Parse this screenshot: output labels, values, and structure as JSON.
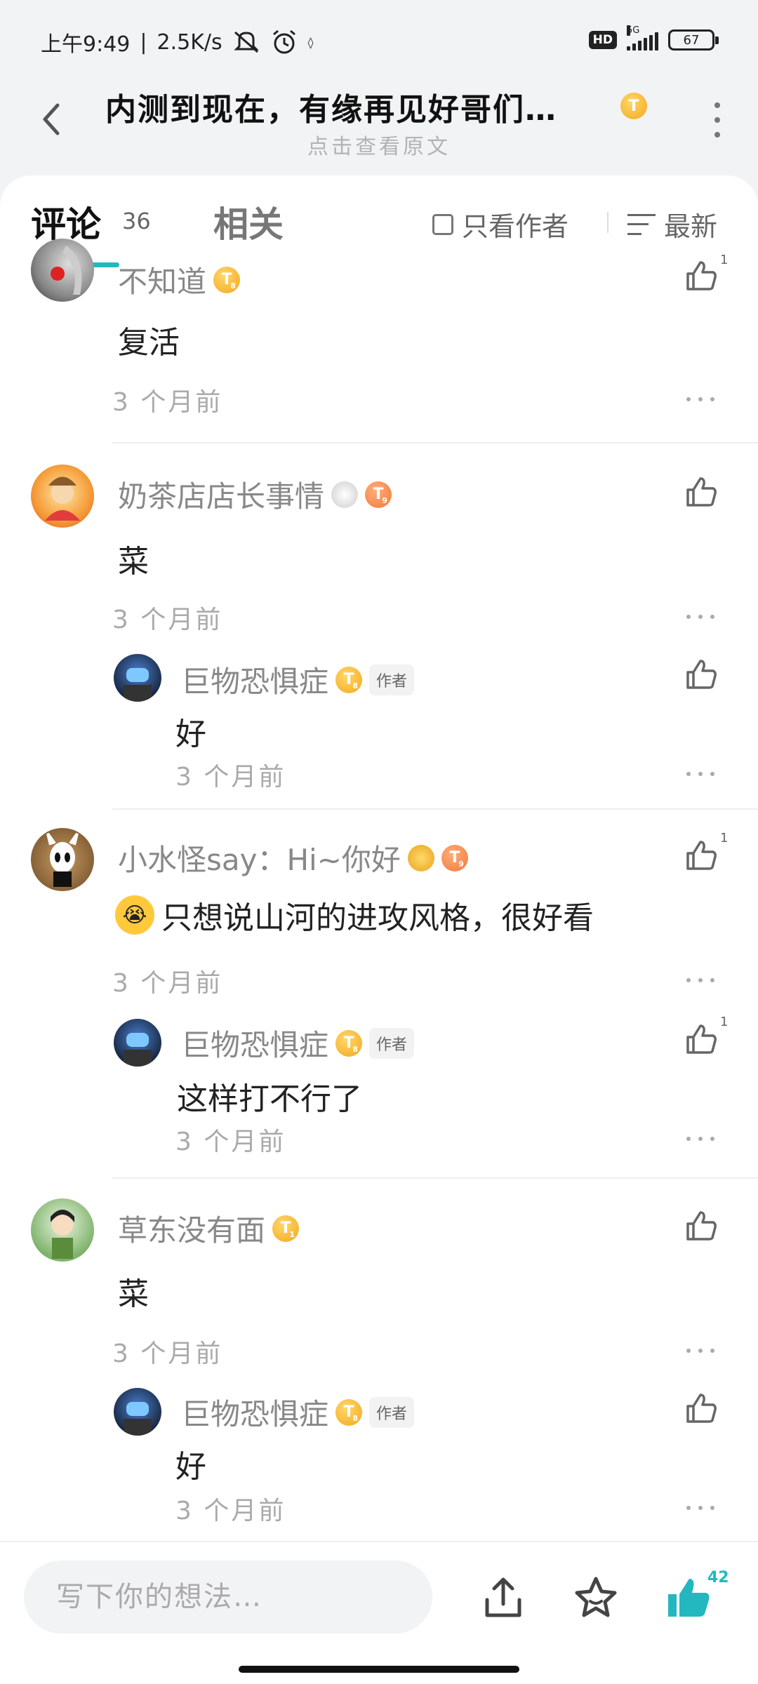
{
  "status_bar": {
    "time": "上午9:49",
    "speed": "2.5K/s",
    "hd": "HD",
    "network": "5G",
    "battery": "67"
  },
  "header": {
    "title": "内测到现在，有缘再见好哥们…",
    "subtitle": "点击查看原文",
    "title_badge": "T"
  },
  "tabs": {
    "comments_label": "评论",
    "comments_count": "36",
    "related_label": "相关",
    "author_only_label": "只看作者",
    "sort_label": "最新"
  },
  "colors": {
    "accent": "#23b8bf",
    "badge_gold": "#f2a81d",
    "badge_orange": "#f07a3a"
  },
  "comments": [
    {
      "name": "不知道",
      "badge": "T",
      "level": "8",
      "text": "复活",
      "time": "3 个月前",
      "likes": "1"
    },
    {
      "name": "奶茶店店长事情",
      "badge": "T",
      "level": "9",
      "text": "菜",
      "time": "3 个月前",
      "likes": "",
      "reply": {
        "name": "巨物恐惧症",
        "badge": "T",
        "level": "8",
        "author_tag": "作者",
        "text": "好",
        "time": "3 个月前",
        "likes": ""
      }
    },
    {
      "name": "小水怪say：Hi~你好",
      "badge": "T",
      "level": "9",
      "text": "只想说山河的进攻风格，很好看",
      "time": "3 个月前",
      "likes": "1",
      "reply": {
        "name": "巨物恐惧症",
        "badge": "T",
        "level": "8",
        "author_tag": "作者",
        "text": "这样打不行了",
        "time": "3 个月前",
        "likes": "1"
      }
    },
    {
      "name": "草东没有面",
      "badge": "T",
      "level": "1",
      "text": "菜",
      "time": "3 个月前",
      "likes": "",
      "reply": {
        "name": "巨物恐惧症",
        "badge": "T",
        "level": "8",
        "author_tag": "作者",
        "text": "好",
        "time": "3 个月前",
        "likes": ""
      }
    }
  ],
  "bottom_bar": {
    "input_placeholder": "写下你的想法…",
    "like_count": "42"
  }
}
